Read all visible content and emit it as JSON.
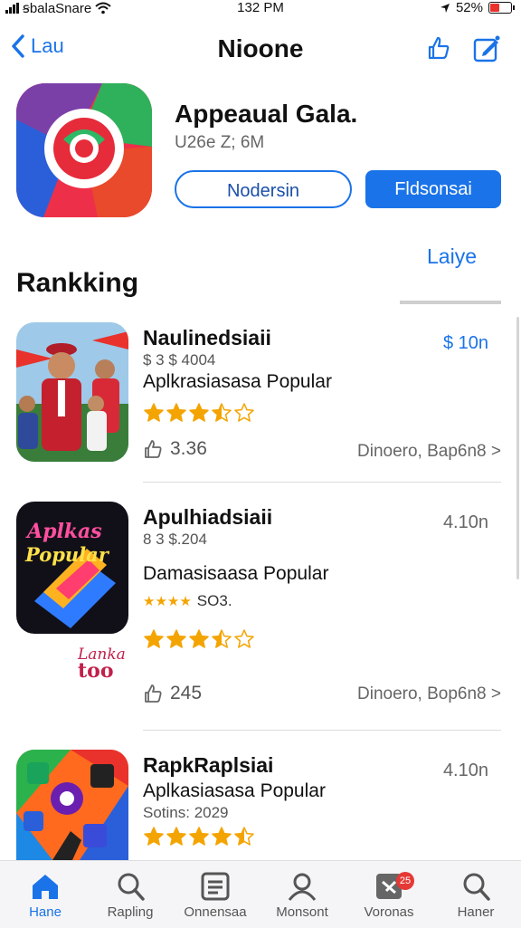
{
  "status_bar": {
    "carrier": "ꞩbalaSnare",
    "time": "132 PM",
    "battery": "52%",
    "battery_level": 0.52
  },
  "nav": {
    "back_label": "Lau",
    "title": "Nioone"
  },
  "app": {
    "name": "Appeaual Gala.",
    "size": "U26e Z; 6M",
    "secondary_button": "Nodersin",
    "primary_button": "Fldsonsai"
  },
  "section": {
    "title": "Rankking",
    "link": "Laiye"
  },
  "rankings": [
    {
      "title": "Naulinedsiaii",
      "sub": "$ 3 $ 4004",
      "desc": "Aplkrasiasasa Popular",
      "price": "$ 10n",
      "rating": 3.5,
      "downloads": "3.36",
      "meta": "Dinoero, Bap6n8 >"
    },
    {
      "title": "Apulhiadsiaii",
      "sub": "8 3 $.204",
      "desc": "Damasisaasa Popular",
      "extra": "SO3.",
      "price": "4.10n",
      "rating": 3.5,
      "downloads": "245",
      "meta": "Dinoero, Bop6n8 >",
      "thumb_text_1": "Aplkas",
      "thumb_text_2": "Popular",
      "side_logo_1": "Lanka",
      "side_logo_2": "too"
    },
    {
      "title": "RapkRaplsiai",
      "desc": "Aplkasiasasa Popular",
      "sub": "Sotins: 2029",
      "price": "4.10n",
      "rating": 4.5
    }
  ],
  "tabs": [
    {
      "label": "Hane",
      "icon": "home-icon",
      "active": true
    },
    {
      "label": "Rapling",
      "icon": "search-icon"
    },
    {
      "label": "Onnensaa",
      "icon": "list-icon"
    },
    {
      "label": "Monsont",
      "icon": "person-icon"
    },
    {
      "label": "Voronas",
      "icon": "updates-icon",
      "badge": "25"
    },
    {
      "label": "Haner",
      "icon": "search-icon"
    }
  ],
  "colors": {
    "accent": "#1a73e8",
    "star": "#f4a400",
    "badge": "#e53935"
  }
}
